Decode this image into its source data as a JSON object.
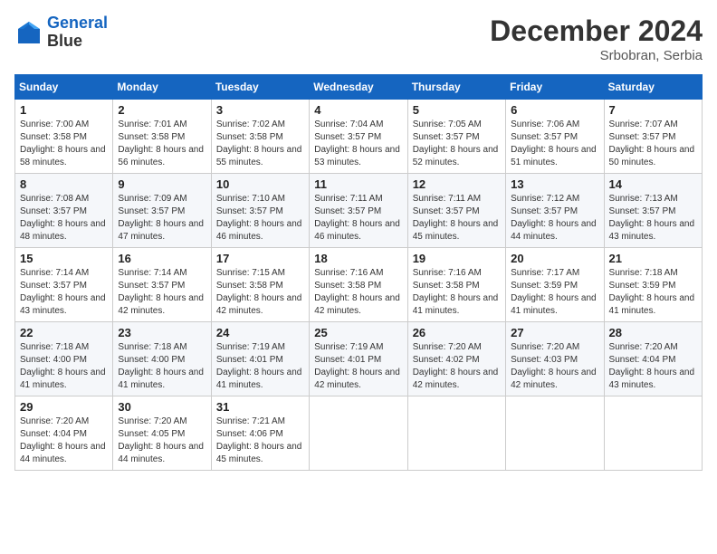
{
  "header": {
    "logo_line1": "General",
    "logo_line2": "Blue",
    "month_title": "December 2024",
    "location": "Srbobran, Serbia"
  },
  "weekdays": [
    "Sunday",
    "Monday",
    "Tuesday",
    "Wednesday",
    "Thursday",
    "Friday",
    "Saturday"
  ],
  "weeks": [
    [
      {
        "day": "1",
        "sunrise": "7:00 AM",
        "sunset": "3:58 PM",
        "daylight": "8 hours and 58 minutes."
      },
      {
        "day": "2",
        "sunrise": "7:01 AM",
        "sunset": "3:58 PM",
        "daylight": "8 hours and 56 minutes."
      },
      {
        "day": "3",
        "sunrise": "7:02 AM",
        "sunset": "3:58 PM",
        "daylight": "8 hours and 55 minutes."
      },
      {
        "day": "4",
        "sunrise": "7:04 AM",
        "sunset": "3:57 PM",
        "daylight": "8 hours and 53 minutes."
      },
      {
        "day": "5",
        "sunrise": "7:05 AM",
        "sunset": "3:57 PM",
        "daylight": "8 hours and 52 minutes."
      },
      {
        "day": "6",
        "sunrise": "7:06 AM",
        "sunset": "3:57 PM",
        "daylight": "8 hours and 51 minutes."
      },
      {
        "day": "7",
        "sunrise": "7:07 AM",
        "sunset": "3:57 PM",
        "daylight": "8 hours and 50 minutes."
      }
    ],
    [
      {
        "day": "8",
        "sunrise": "7:08 AM",
        "sunset": "3:57 PM",
        "daylight": "8 hours and 48 minutes."
      },
      {
        "day": "9",
        "sunrise": "7:09 AM",
        "sunset": "3:57 PM",
        "daylight": "8 hours and 47 minutes."
      },
      {
        "day": "10",
        "sunrise": "7:10 AM",
        "sunset": "3:57 PM",
        "daylight": "8 hours and 46 minutes."
      },
      {
        "day": "11",
        "sunrise": "7:11 AM",
        "sunset": "3:57 PM",
        "daylight": "8 hours and 46 minutes."
      },
      {
        "day": "12",
        "sunrise": "7:11 AM",
        "sunset": "3:57 PM",
        "daylight": "8 hours and 45 minutes."
      },
      {
        "day": "13",
        "sunrise": "7:12 AM",
        "sunset": "3:57 PM",
        "daylight": "8 hours and 44 minutes."
      },
      {
        "day": "14",
        "sunrise": "7:13 AM",
        "sunset": "3:57 PM",
        "daylight": "8 hours and 43 minutes."
      }
    ],
    [
      {
        "day": "15",
        "sunrise": "7:14 AM",
        "sunset": "3:57 PM",
        "daylight": "8 hours and 43 minutes."
      },
      {
        "day": "16",
        "sunrise": "7:14 AM",
        "sunset": "3:57 PM",
        "daylight": "8 hours and 42 minutes."
      },
      {
        "day": "17",
        "sunrise": "7:15 AM",
        "sunset": "3:58 PM",
        "daylight": "8 hours and 42 minutes."
      },
      {
        "day": "18",
        "sunrise": "7:16 AM",
        "sunset": "3:58 PM",
        "daylight": "8 hours and 42 minutes."
      },
      {
        "day": "19",
        "sunrise": "7:16 AM",
        "sunset": "3:58 PM",
        "daylight": "8 hours and 41 minutes."
      },
      {
        "day": "20",
        "sunrise": "7:17 AM",
        "sunset": "3:59 PM",
        "daylight": "8 hours and 41 minutes."
      },
      {
        "day": "21",
        "sunrise": "7:18 AM",
        "sunset": "3:59 PM",
        "daylight": "8 hours and 41 minutes."
      }
    ],
    [
      {
        "day": "22",
        "sunrise": "7:18 AM",
        "sunset": "4:00 PM",
        "daylight": "8 hours and 41 minutes."
      },
      {
        "day": "23",
        "sunrise": "7:18 AM",
        "sunset": "4:00 PM",
        "daylight": "8 hours and 41 minutes."
      },
      {
        "day": "24",
        "sunrise": "7:19 AM",
        "sunset": "4:01 PM",
        "daylight": "8 hours and 41 minutes."
      },
      {
        "day": "25",
        "sunrise": "7:19 AM",
        "sunset": "4:01 PM",
        "daylight": "8 hours and 42 minutes."
      },
      {
        "day": "26",
        "sunrise": "7:20 AM",
        "sunset": "4:02 PM",
        "daylight": "8 hours and 42 minutes."
      },
      {
        "day": "27",
        "sunrise": "7:20 AM",
        "sunset": "4:03 PM",
        "daylight": "8 hours and 42 minutes."
      },
      {
        "day": "28",
        "sunrise": "7:20 AM",
        "sunset": "4:04 PM",
        "daylight": "8 hours and 43 minutes."
      }
    ],
    [
      {
        "day": "29",
        "sunrise": "7:20 AM",
        "sunset": "4:04 PM",
        "daylight": "8 hours and 44 minutes."
      },
      {
        "day": "30",
        "sunrise": "7:20 AM",
        "sunset": "4:05 PM",
        "daylight": "8 hours and 44 minutes."
      },
      {
        "day": "31",
        "sunrise": "7:21 AM",
        "sunset": "4:06 PM",
        "daylight": "8 hours and 45 minutes."
      },
      null,
      null,
      null,
      null
    ]
  ]
}
